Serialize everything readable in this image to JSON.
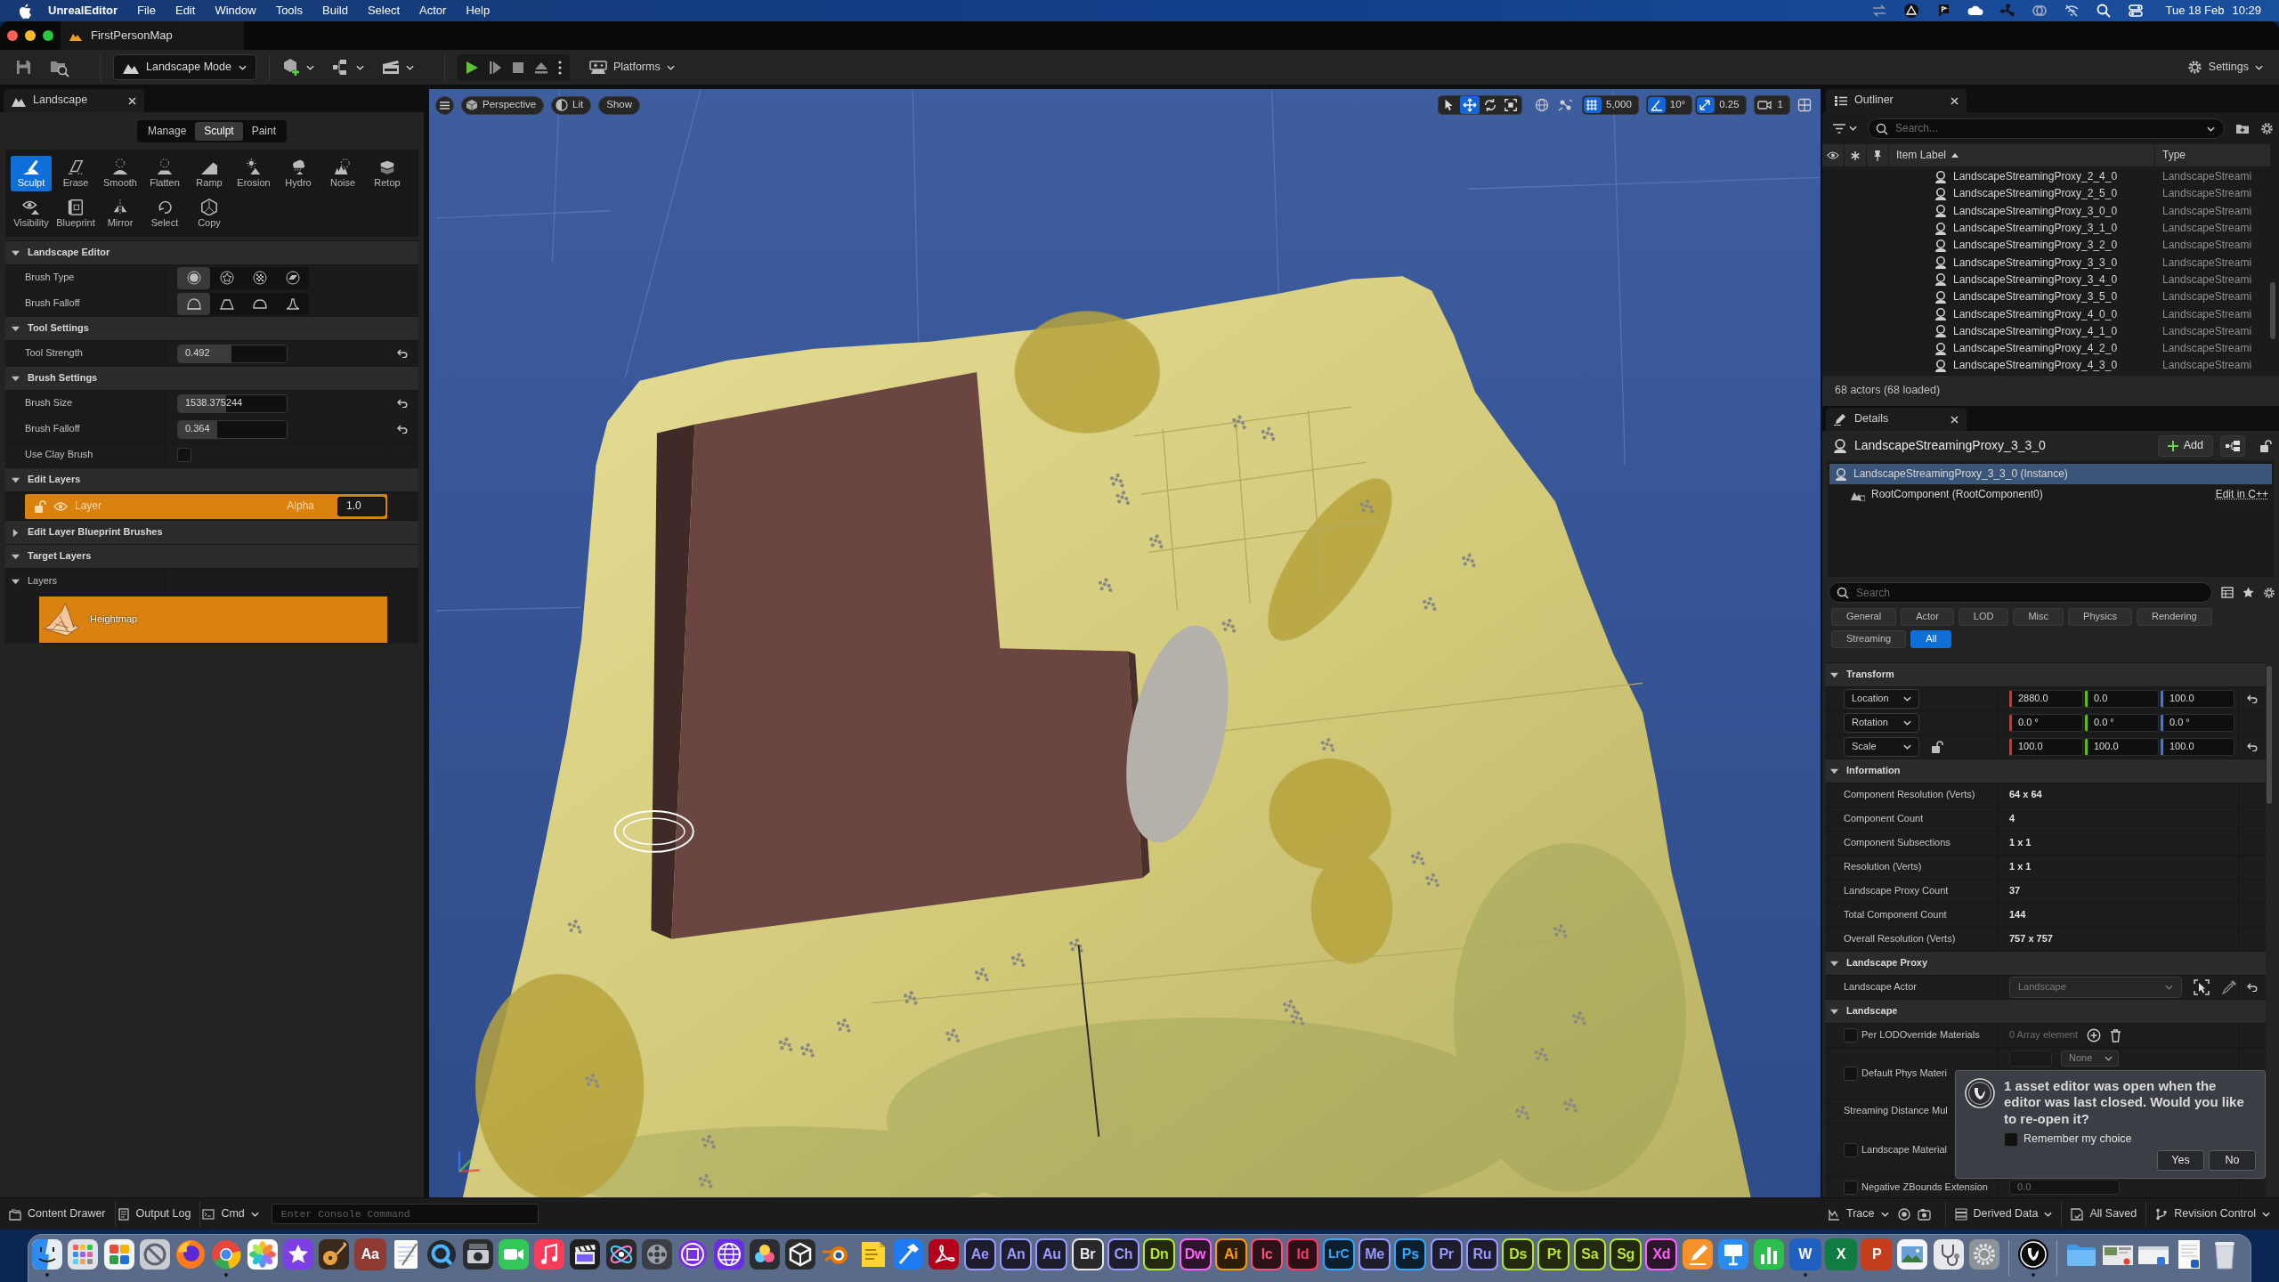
{
  "menubar": {
    "app": "UnrealEditor",
    "menus": [
      "File",
      "Edit",
      "Window",
      "Tools",
      "Build",
      "Select",
      "Actor",
      "Help"
    ],
    "date": "Tue 18 Feb",
    "time": "10:29"
  },
  "window": {
    "tab": "FirstPersonMap"
  },
  "toolbar": {
    "mode": "Landscape Mode",
    "platforms": "Platforms",
    "settings": "Settings"
  },
  "landscape_panel": {
    "title": "Landscape",
    "modes": [
      {
        "label": "Manage",
        "selected": false
      },
      {
        "label": "Sculpt",
        "selected": true
      },
      {
        "label": "Paint",
        "selected": false
      }
    ],
    "tools": [
      {
        "label": "Sculpt",
        "selected": true
      },
      {
        "label": "Erase",
        "selected": false
      },
      {
        "label": "Smooth",
        "selected": false
      },
      {
        "label": "Flatten",
        "selected": false
      },
      {
        "label": "Ramp",
        "selected": false
      },
      {
        "label": "Erosion",
        "selected": false
      },
      {
        "label": "Hydro",
        "selected": false
      },
      {
        "label": "Noise",
        "selected": false
      },
      {
        "label": "Retop",
        "selected": false
      },
      {
        "label": "Visibility",
        "selected": false
      },
      {
        "label": "Blueprint",
        "selected": false
      },
      {
        "label": "Mirror",
        "selected": false
      },
      {
        "label": "Select",
        "selected": false
      },
      {
        "label": "Copy",
        "selected": false
      }
    ],
    "sections": [
      {
        "title": "Landscape Editor",
        "expanded": true,
        "rows": [
          {
            "kind": "icons",
            "label": "Brush Type",
            "options": [
              {
                "selected": true
              },
              {
                "selected": false
              },
              {
                "selected": false
              },
              {
                "selected": false
              }
            ]
          },
          {
            "kind": "icons",
            "label": "Brush Falloff",
            "options": [
              {
                "selected": true
              },
              {
                "selected": false
              },
              {
                "selected": false
              },
              {
                "selected": false
              }
            ]
          }
        ]
      },
      {
        "title": "Tool Settings",
        "expanded": true,
        "rows": [
          {
            "kind": "number",
            "label": "Tool Strength",
            "value": "0.492",
            "level": 0.492,
            "reset": true
          }
        ]
      },
      {
        "title": "Brush Settings",
        "expanded": true,
        "rows": [
          {
            "kind": "number",
            "label": "Brush Size",
            "value": "1538.375244",
            "level": 0.44,
            "reset": true
          },
          {
            "kind": "number",
            "label": "Brush Falloff",
            "value": "0.364",
            "level": 0.364,
            "reset": true
          },
          {
            "kind": "checkbox",
            "label": "Use Clay Brush",
            "checked": false
          }
        ]
      },
      {
        "title": "Edit Layers",
        "expanded": true,
        "rows": [
          {
            "kind": "layer",
            "label": "Layer",
            "alpha_label": "Alpha",
            "alpha": "1.0",
            "selected": true,
            "visible": true,
            "locked": false
          }
        ]
      },
      {
        "title": "Edit Layer Blueprint Brushes",
        "expanded": false
      },
      {
        "title": "Target Layers",
        "expanded": true,
        "rows": [
          {
            "kind": "subheader",
            "label": "Layers",
            "expanded": true
          },
          {
            "kind": "target",
            "label": "Heightmap",
            "selected": true
          }
        ]
      }
    ]
  },
  "viewport": {
    "view": "Perspective",
    "lighting": "Lit",
    "show": "Show",
    "transform_tools": [
      {
        "selected": false
      },
      {
        "selected": true
      },
      {
        "selected": false
      },
      {
        "selected": false
      }
    ],
    "snaps": [
      {
        "value": "5,000",
        "on": true
      },
      {
        "value": "10°",
        "on": true
      },
      {
        "value": "0.25",
        "on": true
      }
    ],
    "camera_speed": "1"
  },
  "outliner": {
    "title": "Outliner",
    "search_placeholder": "Search...",
    "columns": [
      "Item Label",
      "Type"
    ],
    "rows": [
      {
        "label": "LandscapeStreamingProxy_2_4_0",
        "type": "LandscapeStreami",
        "selected": false
      },
      {
        "label": "LandscapeStreamingProxy_2_5_0",
        "type": "LandscapeStreami",
        "selected": false
      },
      {
        "label": "LandscapeStreamingProxy_3_0_0",
        "type": "LandscapeStreami",
        "selected": false
      },
      {
        "label": "LandscapeStreamingProxy_3_1_0",
        "type": "LandscapeStreami",
        "selected": false
      },
      {
        "label": "LandscapeStreamingProxy_3_2_0",
        "type": "LandscapeStreami",
        "selected": false
      },
      {
        "label": "LandscapeStreamingProxy_3_3_0",
        "type": "LandscapeStreami",
        "selected": false
      },
      {
        "label": "LandscapeStreamingProxy_3_4_0",
        "type": "LandscapeStreami",
        "selected": false
      },
      {
        "label": "LandscapeStreamingProxy_3_5_0",
        "type": "LandscapeStreami",
        "selected": false
      },
      {
        "label": "LandscapeStreamingProxy_4_0_0",
        "type": "LandscapeStreami",
        "selected": false
      },
      {
        "label": "LandscapeStreamingProxy_4_1_0",
        "type": "LandscapeStreami",
        "selected": false
      },
      {
        "label": "LandscapeStreamingProxy_4_2_0",
        "type": "LandscapeStreami",
        "selected": false
      },
      {
        "label": "LandscapeStreamingProxy_4_3_0",
        "type": "LandscapeStreami",
        "selected": false
      }
    ],
    "summary": "68 actors (68 loaded)"
  },
  "details": {
    "title": "Details",
    "actor": "LandscapeStreamingProxy_3_3_0",
    "add": "Add",
    "locked": false,
    "components": [
      {
        "label": "LandscapeStreamingProxy_3_3_0 (Instance)",
        "selected": true
      },
      {
        "label": "RootComponent (RootComponent0)",
        "selected": false,
        "link": "Edit in C++"
      }
    ],
    "search_placeholder": "Search",
    "filters": [
      {
        "label": "General",
        "selected": false
      },
      {
        "label": "Actor",
        "selected": false
      },
      {
        "label": "LOD",
        "selected": false
      },
      {
        "label": "Misc",
        "selected": false
      },
      {
        "label": "Physics",
        "selected": false
      },
      {
        "label": "Rendering",
        "selected": false
      },
      {
        "label": "Streaming",
        "selected": false
      },
      {
        "label": "All",
        "selected": true
      }
    ],
    "sections": [
      {
        "title": "Transform",
        "expanded": true,
        "rows": [
          {
            "kind": "vector",
            "label": "Location",
            "values": [
              "2880.0",
              "0.0",
              "100.0"
            ],
            "reset": true
          },
          {
            "kind": "vector",
            "label": "Rotation",
            "values": [
              "0.0 °",
              "0.0 °",
              "0.0 °"
            ],
            "reset": false
          },
          {
            "kind": "vector",
            "label": "Scale",
            "values": [
              "100.0",
              "100.0",
              "100.0"
            ],
            "reset": true,
            "locked": false
          }
        ]
      },
      {
        "title": "Information",
        "expanded": true,
        "rows": [
          {
            "kind": "info",
            "label": "Component Resolution (Verts)",
            "value": "64 x 64"
          },
          {
            "kind": "info",
            "label": "Component Count",
            "value": "4"
          },
          {
            "kind": "info",
            "label": "Component Subsections",
            "value": "1 x 1"
          },
          {
            "kind": "info",
            "label": "Resolution (Verts)",
            "value": "1 x 1"
          },
          {
            "kind": "info",
            "label": "Landscape Proxy Count",
            "value": "37"
          },
          {
            "kind": "info",
            "label": "Total Component Count",
            "value": "144"
          },
          {
            "kind": "info",
            "label": "Overall Resolution (Verts)",
            "value": "757 x 757"
          }
        ]
      },
      {
        "title": "Landscape Proxy",
        "expanded": true,
        "rows": [
          {
            "kind": "actor_picker",
            "label": "Landscape Actor",
            "value": "Landscape",
            "disabled": true,
            "reset": true
          }
        ]
      },
      {
        "title": "Landscape",
        "expanded": true,
        "rows": [
          {
            "kind": "array",
            "label": "Per LODOverride Materials",
            "value": "0 Array element",
            "checked": false
          },
          {
            "kind": "material",
            "label": "Default Phys Materi",
            "value": "None",
            "checked": false
          },
          {
            "kind": "plain",
            "label": "Streaming Distance Mul"
          },
          {
            "kind": "checkbox",
            "label": "Landscape Material",
            "checked": false
          },
          {
            "kind": "number",
            "label": "Negative ZBounds Extension",
            "value": "0.0",
            "checked": false
          }
        ]
      }
    ]
  },
  "notification": {
    "message": "1 asset editor was open when the editor was last closed. Would you like to re-open it?",
    "option": "Remember my choice",
    "checked": false,
    "buttons": [
      "Yes",
      "No"
    ]
  },
  "status_bar": {
    "content_drawer": "Content Drawer",
    "output_log": "Output Log",
    "cmd": "Cmd",
    "console_placeholder": "Enter Console Command",
    "trace": "Trace",
    "derived_data": "Derived Data",
    "saved": "All Saved",
    "revision_control": "Revision Control"
  },
  "dock": {
    "sections": [
      {
        "items": [
          {
            "kind": "app",
            "running": true
          },
          {
            "kind": "app",
            "running": false
          },
          {
            "kind": "app",
            "running": false
          },
          {
            "kind": "app",
            "running": false
          },
          {
            "kind": "app",
            "running": false
          },
          {
            "kind": "app",
            "running": true
          },
          {
            "kind": "app",
            "running": false
          },
          {
            "kind": "app",
            "running": false
          },
          {
            "kind": "app",
            "running": false
          },
          {
            "kind": "badge",
            "label": "Aa",
            "color": "#8f3a33",
            "running": false
          },
          {
            "kind": "app",
            "running": false
          },
          {
            "kind": "app",
            "running": false
          },
          {
            "kind": "app",
            "running": false
          },
          {
            "kind": "app",
            "running": false
          },
          {
            "kind": "app",
            "running": false
          },
          {
            "kind": "app",
            "running": false
          },
          {
            "kind": "app",
            "running": false
          },
          {
            "kind": "app",
            "running": false
          },
          {
            "kind": "app",
            "running": false
          },
          {
            "kind": "app",
            "running": false
          },
          {
            "kind": "app",
            "running": false
          },
          {
            "kind": "app",
            "running": false
          },
          {
            "kind": "app",
            "running": false
          },
          {
            "kind": "app",
            "running": false
          },
          {
            "kind": "app",
            "running": false
          },
          {
            "kind": "app",
            "running": false
          },
          {
            "kind": "letters",
            "label": "Ae",
            "color": "#9999ff",
            "running": false
          },
          {
            "kind": "letters",
            "label": "An",
            "color": "#9999ff",
            "running": false
          },
          {
            "kind": "letters",
            "label": "Au",
            "color": "#9999ff",
            "running": false
          },
          {
            "kind": "letters",
            "label": "Br",
            "color": "#e6e8f0",
            "running": false
          },
          {
            "kind": "letters",
            "label": "Ch",
            "color": "#9999ff",
            "running": false
          },
          {
            "kind": "letters",
            "label": "Dn",
            "color": "#b8e62e",
            "running": false
          },
          {
            "kind": "letters",
            "label": "Dw",
            "color": "#ff61f6",
            "running": false
          },
          {
            "kind": "letters",
            "label": "Ai",
            "color": "#ff9a00",
            "running": false
          },
          {
            "kind": "letters",
            "label": "Ic",
            "color": "#ff4f7b",
            "running": false
          },
          {
            "kind": "letters",
            "label": "Id",
            "color": "#ff3366",
            "running": false
          },
          {
            "kind": "letters",
            "label": "LrC",
            "color": "#31a8ff",
            "running": false
          },
          {
            "kind": "letters",
            "label": "Me",
            "color": "#9999ff",
            "running": false
          },
          {
            "kind": "letters",
            "label": "Ps",
            "color": "#31a8ff",
            "running": false
          },
          {
            "kind": "letters",
            "label": "Pr",
            "color": "#9999ff",
            "running": false
          },
          {
            "kind": "letters",
            "label": "Ru",
            "color": "#9999ff",
            "running": false
          },
          {
            "kind": "letters",
            "label": "Ds",
            "color": "#b8e62e",
            "running": false
          },
          {
            "kind": "letters",
            "label": "Pt",
            "color": "#b8e62e",
            "running": false
          },
          {
            "kind": "letters",
            "label": "Sa",
            "color": "#b8e62e",
            "running": false
          },
          {
            "kind": "letters",
            "label": "Sg",
            "color": "#b8e62e",
            "running": false
          },
          {
            "kind": "letters",
            "label": "Xd",
            "color": "#ff61f6",
            "running": false
          },
          {
            "kind": "app",
            "running": false
          },
          {
            "kind": "app",
            "running": false
          },
          {
            "kind": "app",
            "running": false
          },
          {
            "kind": "badge",
            "label": "W",
            "color": "#1f5fbf",
            "running": true
          },
          {
            "kind": "badge",
            "label": "X",
            "color": "#107c41",
            "running": false
          },
          {
            "kind": "badge",
            "label": "P",
            "color": "#c43e1c",
            "running": false
          },
          {
            "kind": "app",
            "running": false
          },
          {
            "kind": "app",
            "running": false
          },
          {
            "kind": "app",
            "running": false
          }
        ]
      },
      {
        "items": [
          {
            "kind": "app",
            "running": true
          }
        ]
      },
      {
        "items": [
          {
            "kind": "app",
            "running": false
          },
          {
            "kind": "app",
            "running": false
          },
          {
            "kind": "app",
            "running": false
          },
          {
            "kind": "app",
            "running": false
          },
          {
            "kind": "app",
            "running": false
          }
        ]
      }
    ]
  }
}
